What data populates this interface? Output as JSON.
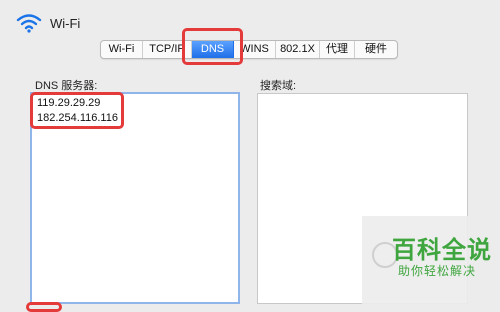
{
  "header": {
    "title": "Wi-Fi",
    "icon": "wifi-icon"
  },
  "tabs": [
    {
      "label": "Wi-Fi"
    },
    {
      "label": "TCP/IP"
    },
    {
      "label": "DNS",
      "active": true
    },
    {
      "label": "WINS"
    },
    {
      "label": "802.1X"
    },
    {
      "label": "代理"
    },
    {
      "label": "硬件"
    }
  ],
  "dns": {
    "label": "DNS 服务器:",
    "servers": [
      "119.29.29.29",
      "182.254.116.116"
    ]
  },
  "search_domains": {
    "label": "搜索域:"
  },
  "watermark": {
    "title": "百科全说",
    "subtitle": "助你轻松解决"
  },
  "colors": {
    "accent": "#1f6fe8",
    "highlight": "#e53a3a",
    "watermark": "#3fa63f",
    "background": "#ececec"
  }
}
